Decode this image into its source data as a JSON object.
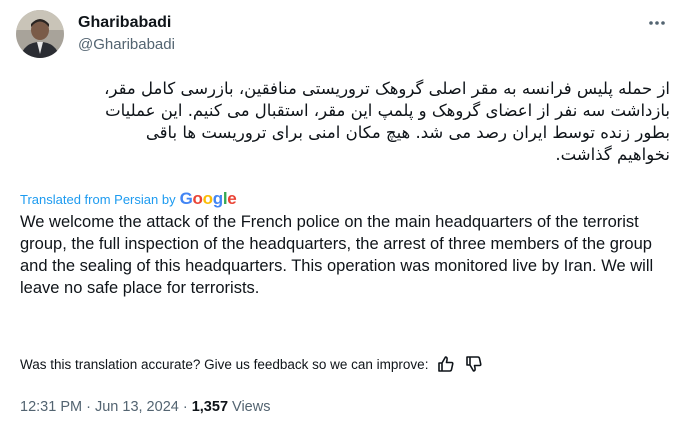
{
  "author": {
    "display_name": "Gharibabadi",
    "handle": "@Gharibabadi"
  },
  "icons": {
    "more": "more-horizontal-icon",
    "thumbs_up": "thumbs-up-icon",
    "thumbs_down": "thumbs-down-icon"
  },
  "tweet": {
    "original_text": "از حمله پلیس فرانسه به مقر اصلی گروهک تروریستی منافقین، بازرسی کامل مقر،\nبازداشت سه نفر از اعضای گروهک و پلمپ این مقر، استقبال می کنیم. این عملیات\nبطور زنده توسط ایران رصد می شد. هیچ مکان امنی برای تروریست ها باقی\nنخواهیم گذاشت.",
    "translated_from": "Translated from Persian by",
    "translator_letters": [
      "G",
      "o",
      "o",
      "g",
      "l",
      "e"
    ],
    "translation": "We welcome the attack of the French police on the main headquarters of the terrorist group, the full inspection of the headquarters, the arrest of three members of the group and the sealing of this headquarters. This operation was monitored live by Iran. We will leave no safe place for terrorists.",
    "feedback_prompt": "Was this translation accurate? Give us feedback so we can improve:"
  },
  "meta": {
    "time": "12:31 PM",
    "separator": " · ",
    "date": "Jun 13, 2024",
    "views_count": "1,357",
    "views_label": " Views"
  },
  "colors": {
    "link_blue": "#1d9bf0",
    "muted_gray": "#536471",
    "text": "#0f1419"
  }
}
